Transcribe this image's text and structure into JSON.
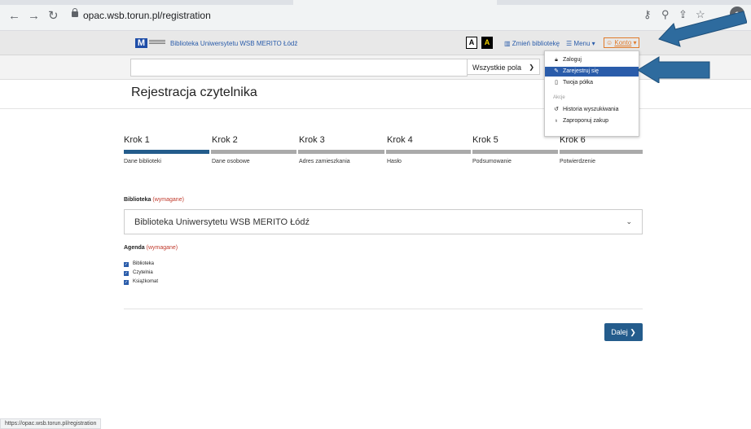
{
  "browser": {
    "back_icon": "back-arrow-icon",
    "forward_icon": "forward-arrow-icon",
    "reload_icon": "reload-icon",
    "url": "opac.wsb.torun.pl/registration"
  },
  "header": {
    "library_name": "Biblioteka Uniwersytetu WSB MERITO Łódź",
    "contrast_normal": "A",
    "contrast_high": "A",
    "change_library": "Zmień bibliotekę",
    "menu": "Menu",
    "account": "Konto"
  },
  "search": {
    "field_select": "Wszystkie pola"
  },
  "account_menu": {
    "items": [
      {
        "label": "Zaloguj",
        "icon": "lock-icon"
      },
      {
        "label": "Zarejestruj się",
        "icon": "edit-icon"
      },
      {
        "label": "Twoja półka",
        "icon": "bookmark-icon"
      }
    ],
    "section_label": "Akcje",
    "actions": [
      {
        "label": "Historia wyszukiwania",
        "icon": "history-icon"
      },
      {
        "label": "Zaproponuj zakup",
        "icon": "lightbulb-icon"
      }
    ]
  },
  "page": {
    "title": "Rejestracja czytelnika"
  },
  "steps": [
    {
      "title": "Krok 1",
      "label": "Dane biblioteki",
      "active": true
    },
    {
      "title": "Krok 2",
      "label": "Dane osobowe",
      "active": false
    },
    {
      "title": "Krok 3",
      "label": "Adres zamieszkania",
      "active": false
    },
    {
      "title": "Krok 4",
      "label": "Hasło",
      "active": false
    },
    {
      "title": "Krok 5",
      "label": "Podsumowanie",
      "active": false
    },
    {
      "title": "Krok 6",
      "label": "Potwierdzenie",
      "active": false
    }
  ],
  "form": {
    "library_label": "Biblioteka",
    "required_text": "(wymagane)",
    "library_value": "Biblioteka Uniwersytetu WSB MERITO Łódź",
    "agenda_label": "Agenda",
    "agenda_required": "(wymagane)",
    "agenda_options": [
      {
        "label": "Biblioteka",
        "checked": true
      },
      {
        "label": "Czytelnia",
        "checked": true
      },
      {
        "label": "Książkomat",
        "checked": true
      }
    ]
  },
  "next_button": "Dalej",
  "status_url": "https://opac.wsb.torun.pl/registration",
  "colors": {
    "accent": "#245c8c",
    "link": "#2a5caa",
    "required": "#c0392b",
    "account_orange": "#e07a2a",
    "annotation_arrow": "#2e6b9e"
  }
}
